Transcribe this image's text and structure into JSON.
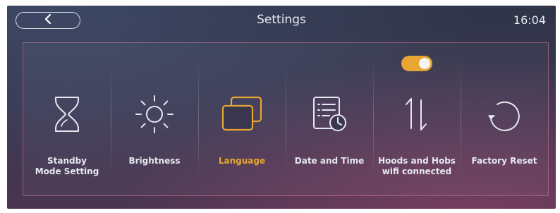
{
  "header": {
    "title": "Settings",
    "time": "16:04"
  },
  "tiles": [
    {
      "label": "Standby\nMode Setting",
      "icon": "hourglass-icon",
      "active": false
    },
    {
      "label": "Brightness",
      "icon": "sun-icon",
      "active": false
    },
    {
      "label": "Language",
      "icon": "stacked-windows-icon",
      "active": true
    },
    {
      "label": "Date and Time",
      "icon": "calendar-clock-icon",
      "active": false
    },
    {
      "label": "Hoods and Hobs\nwifi connected",
      "icon": "up-down-arrows-icon",
      "active": false,
      "toggle_on": true
    },
    {
      "label": "Factory Reset",
      "icon": "reset-arrow-icon",
      "active": false
    }
  ],
  "colors": {
    "accent": "#e8a632",
    "text": "#e6e8ef",
    "panel_border": "#d27896"
  }
}
